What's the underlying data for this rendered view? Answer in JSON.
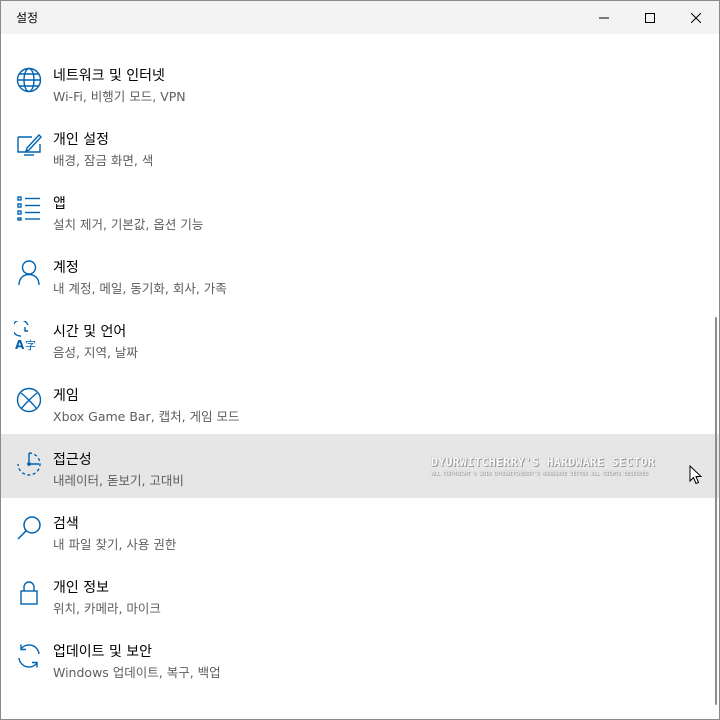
{
  "window": {
    "title": "설정"
  },
  "items": [
    {
      "icon": "globe-icon",
      "label": "네트워크 및 인터넷",
      "desc": "Wi-Fi, 비행기 모드, VPN"
    },
    {
      "icon": "personalization-icon",
      "label": "개인 설정",
      "desc": "배경, 잠금 화면, 색"
    },
    {
      "icon": "apps-list-icon",
      "label": "앱",
      "desc": "설치 제거, 기본값, 옵션 기능"
    },
    {
      "icon": "person-icon",
      "label": "계정",
      "desc": "내 계정, 메일, 동기화, 회사, 가족"
    },
    {
      "icon": "time-language-icon",
      "label": "시간 및 언어",
      "desc": "음성, 지역, 날짜"
    },
    {
      "icon": "xbox-icon",
      "label": "게임",
      "desc": "Xbox Game Bar, 캡처, 게임 모드"
    },
    {
      "icon": "ease-of-access-icon",
      "label": "접근성",
      "desc": "내레이터, 돋보기, 고대비"
    },
    {
      "icon": "search-icon",
      "label": "검색",
      "desc": "내 파일 찾기, 사용 권한"
    },
    {
      "icon": "lock-icon",
      "label": "개인 정보",
      "desc": "위치, 카메라, 마이크"
    },
    {
      "icon": "update-sync-icon",
      "label": "업데이트 및 보안",
      "desc": "Windows 업데이트, 복구, 백업"
    }
  ],
  "watermark": {
    "main": "DYURWITCHERRY'S HARDWARE SECTOR",
    "sub": "ALL COPYRIGHT © 2016 DYURWITCHERRY'S HARDWARE SECTOR ALL RIGHTS RESERVED"
  },
  "colors": {
    "titlebar": "#f3f3f3",
    "hover": "#e6e6e6",
    "accent": "#0063b1",
    "secondary_text": "#5e5e5e"
  }
}
